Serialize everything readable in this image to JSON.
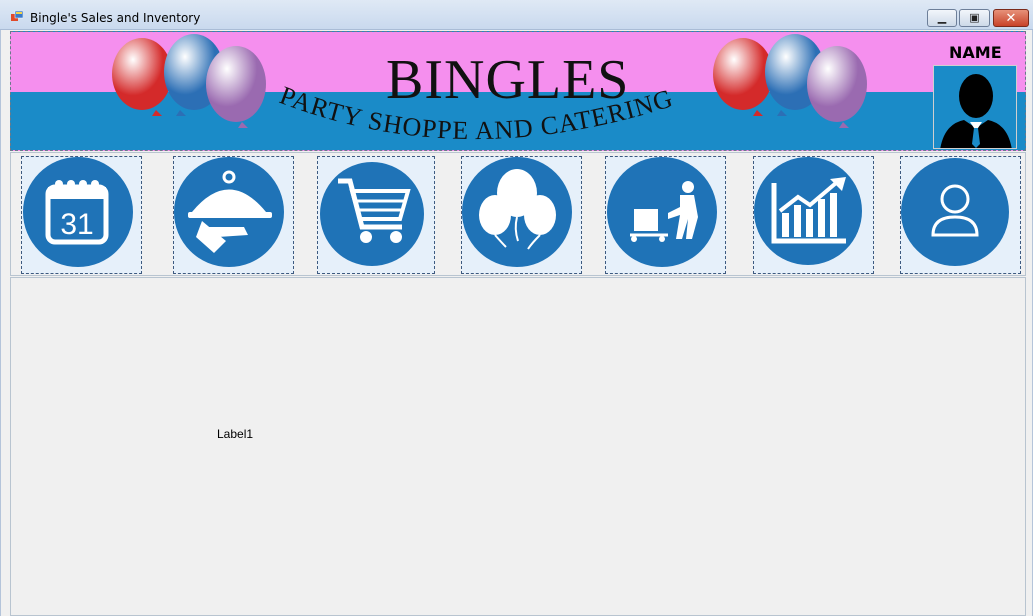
{
  "window": {
    "title": "Bingle's Sales and Inventory",
    "controls": {
      "minimize": "minimize",
      "maximize": "maximize",
      "close": "close"
    }
  },
  "banner": {
    "brand": "BINGLES",
    "tagline": "PARTY SHOPPE AND CATERING",
    "colors": {
      "top": "#f58fee",
      "bottom": "#1a8bc8"
    }
  },
  "user": {
    "name_label": "NAME",
    "avatar_icon": "user-silhouette-icon"
  },
  "nav": {
    "items": [
      {
        "icon": "calendar-icon",
        "text": "31"
      },
      {
        "icon": "catering-serving-icon"
      },
      {
        "icon": "shopping-cart-icon"
      },
      {
        "icon": "balloons-icon"
      },
      {
        "icon": "delivery-trolley-icon"
      },
      {
        "icon": "sales-chart-icon"
      },
      {
        "icon": "user-account-icon"
      }
    ],
    "accent": "#1f73b7"
  },
  "content": {
    "label1": "Label1"
  }
}
